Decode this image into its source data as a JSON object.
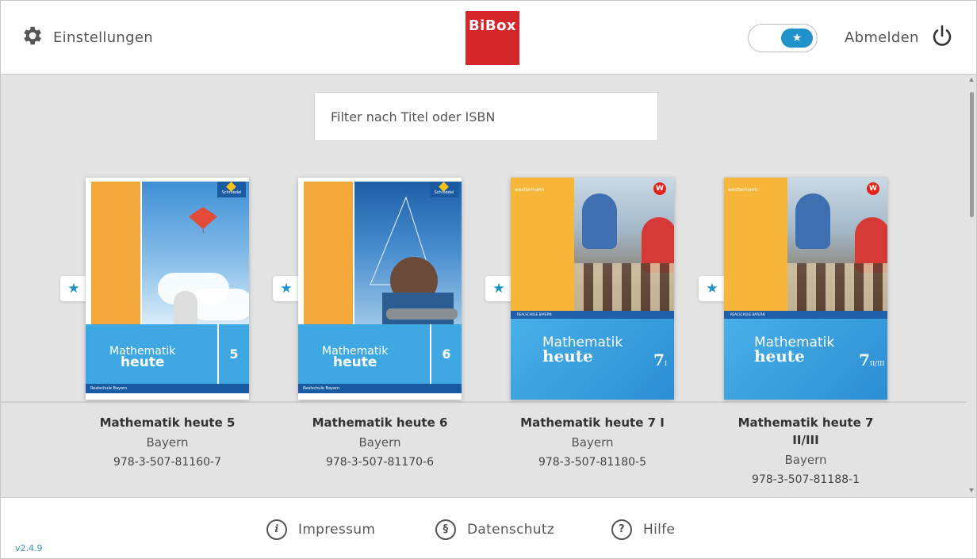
{
  "header": {
    "settings_label": "Einstellungen",
    "logo_text": "BiBox",
    "toggle_icon": "★",
    "logout_label": "Abmelden"
  },
  "filter": {
    "placeholder": "Filter nach Titel oder ISBN"
  },
  "books": [
    {
      "title": "Mathematik heute 5",
      "region": "Bayern",
      "isbn": "978-3-507-81160-7",
      "cover_series": "Mathematik",
      "cover_sub": "heute",
      "cover_number": "5",
      "cover_band": "Realschule Bayern",
      "publisher": "Schroedel"
    },
    {
      "title": "Mathematik heute 6",
      "region": "Bayern",
      "isbn": "978-3-507-81170-6",
      "cover_series": "Mathematik",
      "cover_sub": "heute",
      "cover_number": "6",
      "cover_band": "Realschule Bayern",
      "publisher": "Schroedel"
    },
    {
      "title": "Mathematik heute 7 I",
      "region": "Bayern",
      "isbn": "978-3-507-81180-5",
      "cover_series": "Mathematik",
      "cover_sub": "heute",
      "cover_number": "7",
      "cover_number_suffix": "I",
      "cover_band": "REALSCHULE BAYERN",
      "publisher": "westermann"
    },
    {
      "title": "Mathematik heute 7 II/III",
      "region": "Bayern",
      "isbn": "978-3-507-81188-1",
      "cover_series": "Mathematik",
      "cover_sub": "heute",
      "cover_number": "7",
      "cover_number_suffix": "II/III",
      "cover_band": "REALSCHULE BAYERN",
      "publisher": "westermann"
    }
  ],
  "favorite_icon": "★",
  "footer": {
    "impressum": "Impressum",
    "datenschutz": "Datenschutz",
    "hilfe": "Hilfe",
    "impressum_icon": "i",
    "datenschutz_icon": "§",
    "hilfe_icon": "?",
    "version": "v2.4.9"
  },
  "colors": {
    "accent": "#1f92cb",
    "logo_red": "#d5262b",
    "shelf_bg": "#e3e3e3"
  }
}
